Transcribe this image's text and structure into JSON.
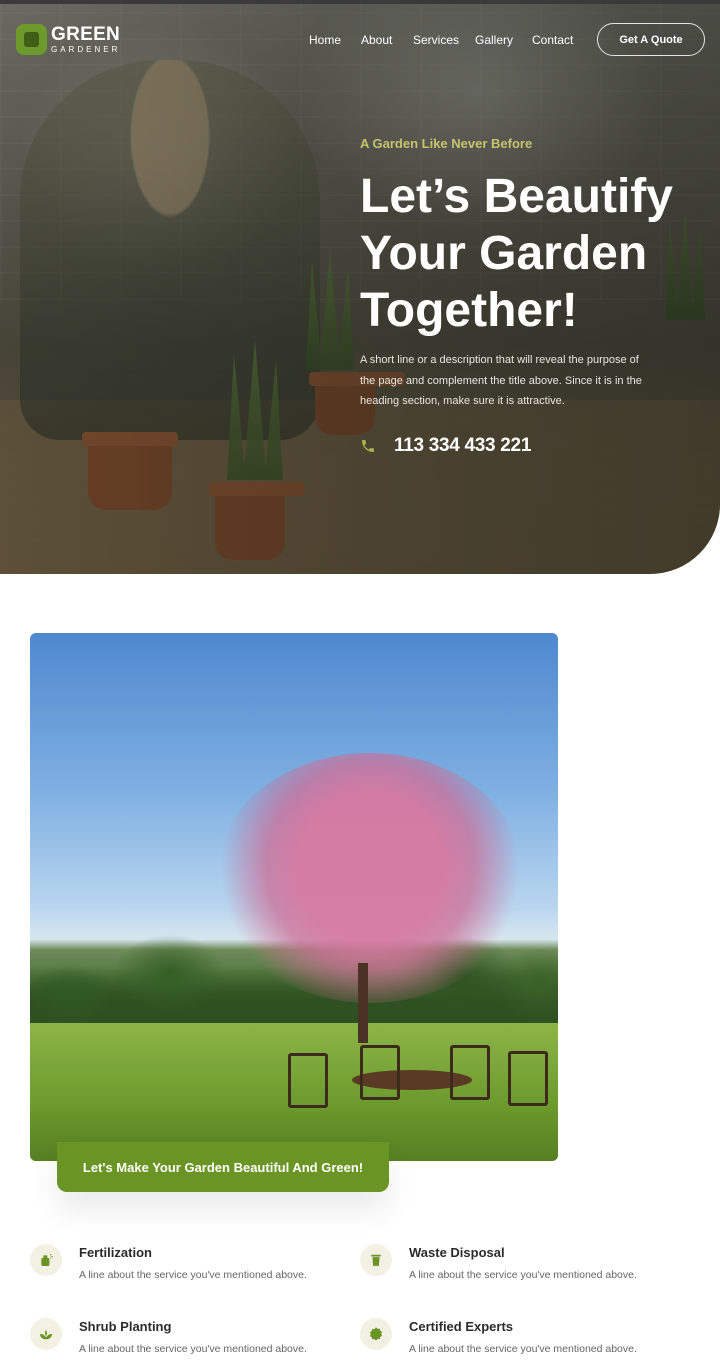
{
  "brand": {
    "name_line1": "GREEN",
    "name_line2": "GARDENER",
    "accent": "#6a9524"
  },
  "nav": {
    "items": [
      "Home",
      "About",
      "Services",
      "Gallery",
      "Contact"
    ],
    "cta_label": "Get A Quote"
  },
  "hero": {
    "eyebrow": "A Garden Like Never Before",
    "title": "Let’s Beautify Your Garden Together!",
    "description": "A short line or a description that will reveal the purpose of the page and complement the title above. Since it is in the heading section, make sure it is attractive.",
    "phone": "113 334 433 221",
    "phone_icon": "phone-icon"
  },
  "about": {
    "banner_label": "Let's Make Your Garden Beautiful And Green!"
  },
  "services": [
    {
      "title": "Fertilization",
      "description": "A line about the service you've mentioned above.",
      "icon": "fertilizer-sprayer-icon"
    },
    {
      "title": "Waste Disposal",
      "description": "A line about the service you've mentioned above.",
      "icon": "trash-bin-icon"
    },
    {
      "title": "Shrub Planting",
      "description": "A line about the service you've mentioned above.",
      "icon": "sprout-icon"
    },
    {
      "title": "Certified Experts",
      "description": "A line about the service you've mentioned above.",
      "icon": "certified-badge-icon"
    }
  ]
}
